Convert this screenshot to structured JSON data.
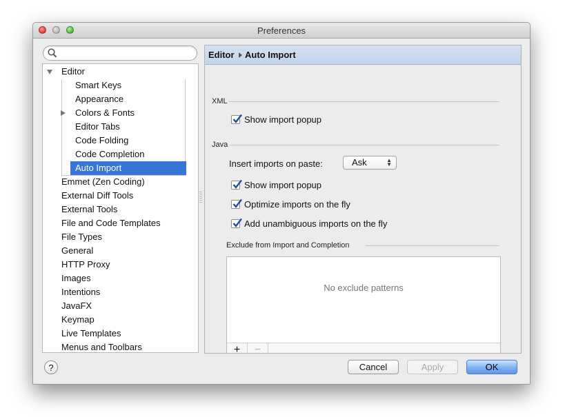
{
  "window": {
    "title": "Preferences"
  },
  "search": {
    "placeholder": "",
    "value": ""
  },
  "tree": {
    "editor": {
      "label": "Editor",
      "expanded": true
    },
    "editor_children": [
      {
        "label": "Smart Keys"
      },
      {
        "label": "Appearance"
      },
      {
        "label": "Colors & Fonts",
        "has_children": true
      },
      {
        "label": "Editor Tabs"
      },
      {
        "label": "Code Folding"
      },
      {
        "label": "Code Completion"
      },
      {
        "label": "Auto Import",
        "selected": true
      }
    ],
    "items": [
      {
        "label": "Emmet (Zen Coding)"
      },
      {
        "label": "External Diff Tools"
      },
      {
        "label": "External Tools"
      },
      {
        "label": "File and Code Templates"
      },
      {
        "label": "File Types"
      },
      {
        "label": "General"
      },
      {
        "label": "HTTP Proxy"
      },
      {
        "label": "Images"
      },
      {
        "label": "Intentions"
      },
      {
        "label": "JavaFX"
      },
      {
        "label": "Keymap"
      },
      {
        "label": "Live Templates"
      },
      {
        "label": "Menus and Toolbars"
      }
    ]
  },
  "panel": {
    "breadcrumb": [
      "Editor",
      "Auto Import"
    ],
    "xml": {
      "section": "XML",
      "show_import_popup": {
        "label": "Show import popup",
        "checked": true
      }
    },
    "java": {
      "section": "Java",
      "insert_on_paste": {
        "label": "Insert imports on paste:",
        "value": "Ask"
      },
      "show_import_popup": {
        "label": "Show import popup",
        "checked": true
      },
      "optimize_on_fly": {
        "label": "Optimize imports on the fly",
        "checked": true
      },
      "add_unambiguous": {
        "label": "Add unambiguous imports on the fly",
        "checked": true
      }
    },
    "exclude": {
      "section": "Exclude from Import and Completion",
      "empty_text": "No exclude patterns",
      "add_label": "+",
      "remove_label": "−"
    }
  },
  "footer": {
    "help_label": "?",
    "cancel_label": "Cancel",
    "apply_label": "Apply",
    "ok_label": "OK"
  },
  "colors": {
    "selection": "#3875d7",
    "header_bg": "#c8d8ee",
    "ok_button": "#6aa2ec"
  }
}
